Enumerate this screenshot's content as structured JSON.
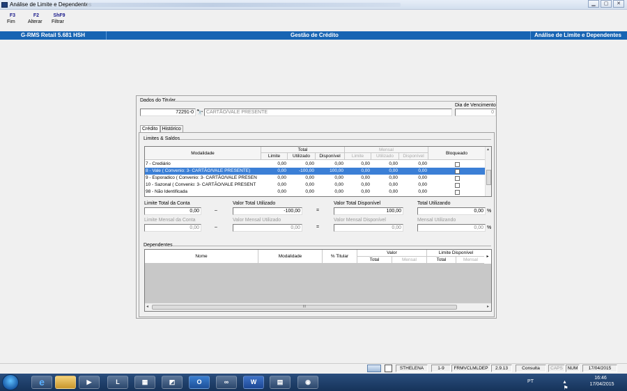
{
  "window": {
    "title": "Análise de Limite e Dependentes",
    "controls": [
      "minimize-icon",
      "maximize-icon",
      "close-icon"
    ]
  },
  "toolbar": [
    {
      "key": "F3",
      "label": "Fim"
    },
    {
      "key": "F2",
      "label": "Alterar"
    },
    {
      "key": "ShF9",
      "label": "Filtrar"
    }
  ],
  "header": {
    "app": "G-RMS Retail 5.681 HSH",
    "module": "Gestão de Crédito",
    "screen": "Análise de Limite e Dependentes"
  },
  "titular": {
    "group_label": "Dados do Titular",
    "code": "72291-0",
    "name": "CARTÃO/VALE PRESENTE",
    "vencimento_label": "Dia de Vencimento",
    "vencimento": "0"
  },
  "tabs": [
    "Crédito",
    "Histórico"
  ],
  "limites": {
    "group_label": "Limites & Saldos",
    "headers": {
      "modalidade": "Modalidade",
      "total": "Total",
      "mensal": "Mensal",
      "bloqueado": "Bloqueado",
      "limite": "Limite",
      "utilizado": "Utilizado",
      "disponivel": "Disponível"
    },
    "rows": [
      {
        "modalidade": "7 - Crediário",
        "t_lim": "0,00",
        "t_uti": "0,00",
        "t_dis": "0,00",
        "m_lim": "0,00",
        "m_uti": "0,00",
        "m_dis": "0,00",
        "selected": false
      },
      {
        "modalidade": "8 - Vale ( Convenio: 3- CARTÃO/VALE PRESENTE)",
        "t_lim": "0,00",
        "t_uti": "-100,00",
        "t_dis": "100,00",
        "m_lim": "0,00",
        "m_uti": "0,00",
        "m_dis": "0,00",
        "selected": true
      },
      {
        "modalidade": "9 - Esporadico ( Convenio: 3- CARTÃO/VALE PRESEN",
        "t_lim": "0,00",
        "t_uti": "0,00",
        "t_dis": "0,00",
        "m_lim": "0,00",
        "m_uti": "0,00",
        "m_dis": "0,00",
        "selected": false
      },
      {
        "modalidade": "10 - Sazonal ( Convenio: 3- CARTÃO/VALE PRESENT",
        "t_lim": "0,00",
        "t_uti": "0,00",
        "t_dis": "0,00",
        "m_lim": "0,00",
        "m_uti": "0,00",
        "m_dis": "0,00",
        "selected": false
      },
      {
        "modalidade": "98 - Não Identificada",
        "t_lim": "0,00",
        "t_uti": "0,00",
        "t_dis": "0,00",
        "m_lim": "0,00",
        "m_uti": "0,00",
        "m_dis": "0,00",
        "selected": false
      }
    ]
  },
  "totals": {
    "limite_total_label": "Limite Total da Conta",
    "limite_total": "0,00",
    "valor_utilizado_label": "Valor Total Utilizado",
    "valor_utilizado": "-100,00",
    "valor_disponivel_label": "Valor Total Disponível",
    "valor_disponivel": "100,00",
    "total_utilizando_label": "Total Utilizando",
    "total_utilizando": "0,00",
    "limite_mensal_label": "Limite Mensal da Conta",
    "limite_mensal": "0,00",
    "mensal_utilizado_label": "Valor Mensal Utilizado",
    "mensal_utilizado": "0,00",
    "mensal_disponivel_label": "Valor Mensal Disponível",
    "mensal_disponivel": "0,00",
    "mensal_utilizando_label": "Mensal Utilizando",
    "mensal_utilizando": "0,00",
    "minus": "–",
    "equals": "=",
    "percent": "%"
  },
  "dependentes": {
    "group_label": "Dependentes",
    "headers": {
      "nome": "Nome",
      "modalidade": "Modalidade",
      "titular": "% Titular",
      "valor": "Valor",
      "limite_disp": "Limite Disponível",
      "total": "Total",
      "mensal": "Mensal"
    },
    "scroll_grip": "III"
  },
  "statusbar": {
    "user": "STHELENA",
    "range": "1-9",
    "form": "FRMVCLMLDEP",
    "version": "2.9.13",
    "mode": "Consulta",
    "caps": "CAPS",
    "num": "NUM",
    "date": "17/04/2015"
  },
  "taskbar": {
    "lang": "PT",
    "time": "16:46",
    "date": "17/04/2015"
  }
}
